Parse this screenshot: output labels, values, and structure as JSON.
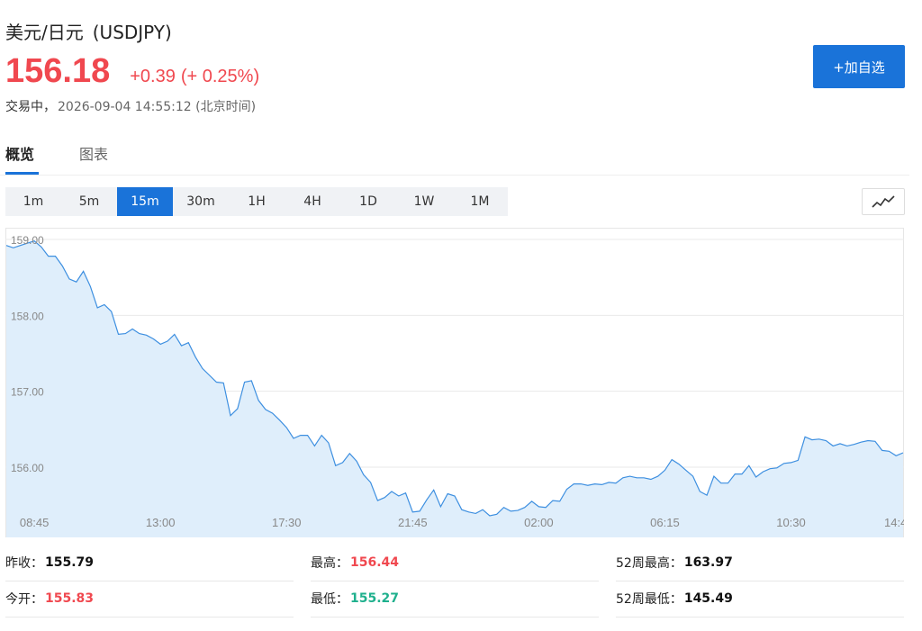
{
  "header": {
    "name": "美元/日元",
    "code": "(USDJPY)",
    "price": "156.18",
    "change": "+0.39",
    "change_pct": "(+ 0.25%)",
    "status": "交易中，",
    "timestamp": "2026-09-04 14:55:12 (北京时间)",
    "add_watchlist_label": "+加自选"
  },
  "tabs": [
    {
      "label": "概览",
      "active": true
    },
    {
      "label": "图表",
      "active": false
    }
  ],
  "intervals": [
    {
      "label": "1m",
      "active": false
    },
    {
      "label": "5m",
      "active": false
    },
    {
      "label": "15m",
      "active": true
    },
    {
      "label": "30m",
      "active": false
    },
    {
      "label": "1H",
      "active": false
    },
    {
      "label": "4H",
      "active": false
    },
    {
      "label": "1D",
      "active": false
    },
    {
      "label": "1W",
      "active": false
    },
    {
      "label": "1M",
      "active": false
    }
  ],
  "chart_type_icon": "line-chart-icon",
  "colors": {
    "accent": "#1a73d9",
    "up": "#f0484f",
    "down": "#1fb08d",
    "line": "#3d8fe0",
    "fill": "#dfeefb"
  },
  "chart_data": {
    "type": "area",
    "title": "",
    "xlabel": "",
    "ylabel": "",
    "ylim": [
      155.3,
      159.1
    ],
    "y_ticks": [
      "159.00",
      "158.00",
      "157.00",
      "156.00"
    ],
    "y_tick_values": [
      159,
      158,
      157,
      156
    ],
    "x_tick_labels": [
      "08:45",
      "13:00",
      "17:30",
      "21:45",
      "02:00",
      "06:15",
      "10:30",
      "14:4"
    ],
    "x_tick_index": [
      4,
      22,
      40,
      58,
      76,
      94,
      112,
      130
    ],
    "grid": true,
    "series": [
      {
        "values": [
          158.92,
          158.89,
          158.92,
          158.95,
          158.98,
          158.9,
          158.78,
          158.78,
          158.65,
          158.48,
          158.44,
          158.58,
          158.38,
          158.1,
          158.14,
          158.05,
          157.75,
          157.76,
          157.82,
          157.76,
          157.74,
          157.69,
          157.62,
          157.66,
          157.75,
          157.6,
          157.64,
          157.45,
          157.3,
          157.21,
          157.12,
          157.11,
          156.68,
          156.77,
          157.12,
          157.14,
          156.88,
          156.76,
          156.71,
          156.62,
          156.52,
          156.38,
          156.42,
          156.42,
          156.28,
          156.42,
          156.32,
          156.02,
          156.06,
          156.18,
          156.08,
          155.9,
          155.8,
          155.56,
          155.6,
          155.68,
          155.62,
          155.66,
          155.41,
          155.42,
          155.57,
          155.7,
          155.48,
          155.65,
          155.62,
          155.44,
          155.41,
          155.39,
          155.44,
          155.36,
          155.38,
          155.47,
          155.42,
          155.43,
          155.47,
          155.55,
          155.48,
          155.47,
          155.56,
          155.55,
          155.71,
          155.78,
          155.78,
          155.76,
          155.78,
          155.77,
          155.8,
          155.79,
          155.86,
          155.88,
          155.86,
          155.86,
          155.84,
          155.88,
          155.96,
          156.1,
          156.04,
          155.96,
          155.88,
          155.68,
          155.63,
          155.88,
          155.79,
          155.79,
          155.91,
          155.91,
          156.02,
          155.87,
          155.94,
          155.98,
          155.99,
          156.05,
          156.06,
          156.09,
          156.4,
          156.36,
          156.37,
          156.35,
          156.28,
          156.31,
          156.28,
          156.3,
          156.33,
          156.35,
          156.34,
          156.22,
          156.21,
          156.15,
          156.19
        ]
      }
    ]
  },
  "stats": [
    {
      "label": "昨收：",
      "value": "155.79",
      "color": "dark"
    },
    {
      "label": "最高：",
      "value": "156.44",
      "color": "red"
    },
    {
      "label": "52周最高：",
      "value": "163.97",
      "color": "dark"
    },
    {
      "label": "今开：",
      "value": "155.83",
      "color": "red"
    },
    {
      "label": "最低：",
      "value": "155.27",
      "color": "green"
    },
    {
      "label": "52周最低：",
      "value": "145.49",
      "color": "dark"
    }
  ]
}
